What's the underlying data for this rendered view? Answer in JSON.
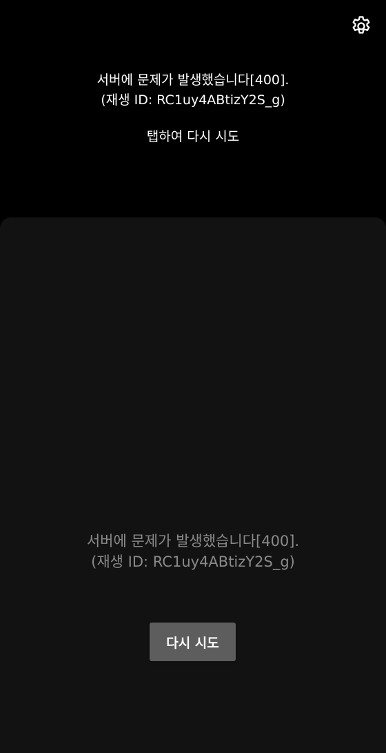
{
  "player": {
    "error_line1": "서버에 문제가 발생했습니다[400].",
    "error_line2": "(재생 ID: RC1uy4ABtizY2S_g)",
    "retry_text": "탭하여 다시 시도",
    "settings_icon": "gear-icon"
  },
  "sheet": {
    "error_line1": "서버에 문제가 발생했습니다[400].",
    "error_line2": "(재생 ID: RC1uy4ABtizY2S_g)",
    "retry_button_label": "다시 시도"
  },
  "colors": {
    "background": "#000000",
    "sheet_background": "#121212",
    "primary_text": "#ffffff",
    "secondary_text": "#8a8a8a",
    "button_background": "#5d5d5d"
  }
}
